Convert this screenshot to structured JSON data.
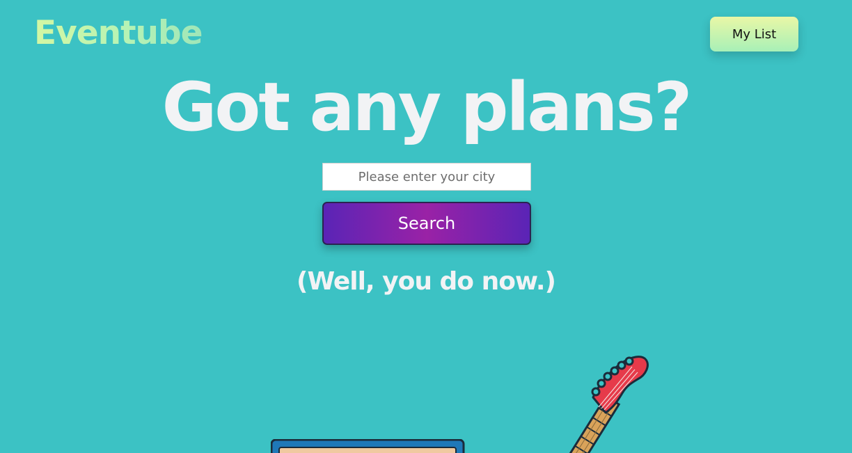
{
  "header": {
    "logo": "Eventube",
    "my_list_label": "My List"
  },
  "hero": {
    "headline": "Got any plans?",
    "tagline": "(Well, you do now.)"
  },
  "search": {
    "placeholder": "Please enter your city",
    "value": "",
    "button_label": "Search"
  },
  "illustrations": {
    "amp_icon": "amplifier-icon",
    "guitar_icon": "electric-guitar-icon"
  },
  "colors": {
    "background": "#3cc2c4",
    "headline": "#f2f3f5",
    "search_gradient_start": "#5a24b6",
    "search_gradient_mid": "#9a22a6",
    "mylist_gradient_top": "#e9f7a6",
    "mylist_gradient_bottom": "#a8f0b7",
    "guitar_head": "#e63a4a"
  }
}
